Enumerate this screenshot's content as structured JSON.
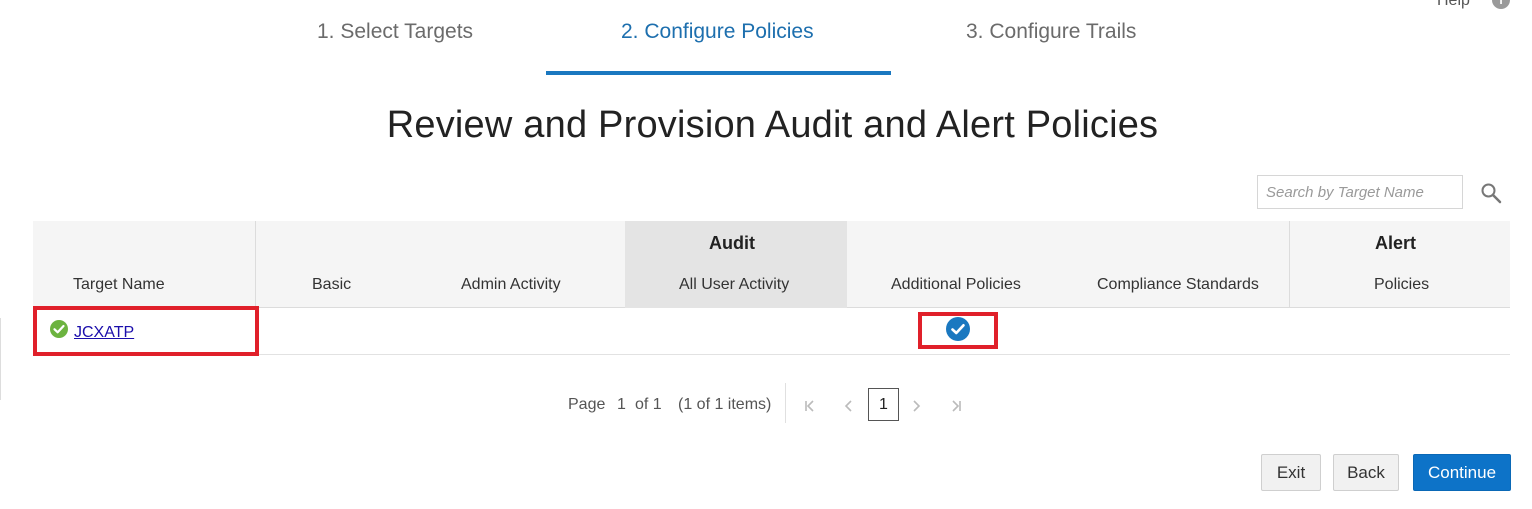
{
  "help": {
    "label": "Help",
    "icon": "help-icon"
  },
  "steps": [
    {
      "label": "1. Select Targets",
      "active": false
    },
    {
      "label": "2. Configure Policies",
      "active": true
    },
    {
      "label": "3. Configure Trails",
      "active": false
    }
  ],
  "page_title": "Review and Provision Audit and Alert Policies",
  "search": {
    "placeholder": "Search by Target Name",
    "value": "",
    "icon": "search-icon"
  },
  "table": {
    "groups": {
      "audit": "Audit",
      "alert": "Alert"
    },
    "columns": [
      "Target Name",
      "Basic",
      "Admin Activity",
      "All User Activity",
      "Additional Policies",
      "Compliance Standards",
      "Policies"
    ],
    "rows": [
      {
        "target_name": "JCXATP",
        "status_icon": "success-check-icon",
        "additional_policies": "checked-circle-icon"
      }
    ]
  },
  "pagination": {
    "page_label": "Page",
    "current_page": "1",
    "of_label": "of 1",
    "items_label": "(1 of 1 items)",
    "page_button": "1",
    "nav": {
      "first": "K",
      "prev": "‹",
      "next": "›",
      "last": "⟩|"
    }
  },
  "buttons": {
    "exit": "Exit",
    "back": "Back",
    "continue": "Continue"
  },
  "colors": {
    "accent": "#1a78c0",
    "primary_button": "#0d73c8",
    "highlight": "#e0202a",
    "success": "#6cb33f"
  }
}
